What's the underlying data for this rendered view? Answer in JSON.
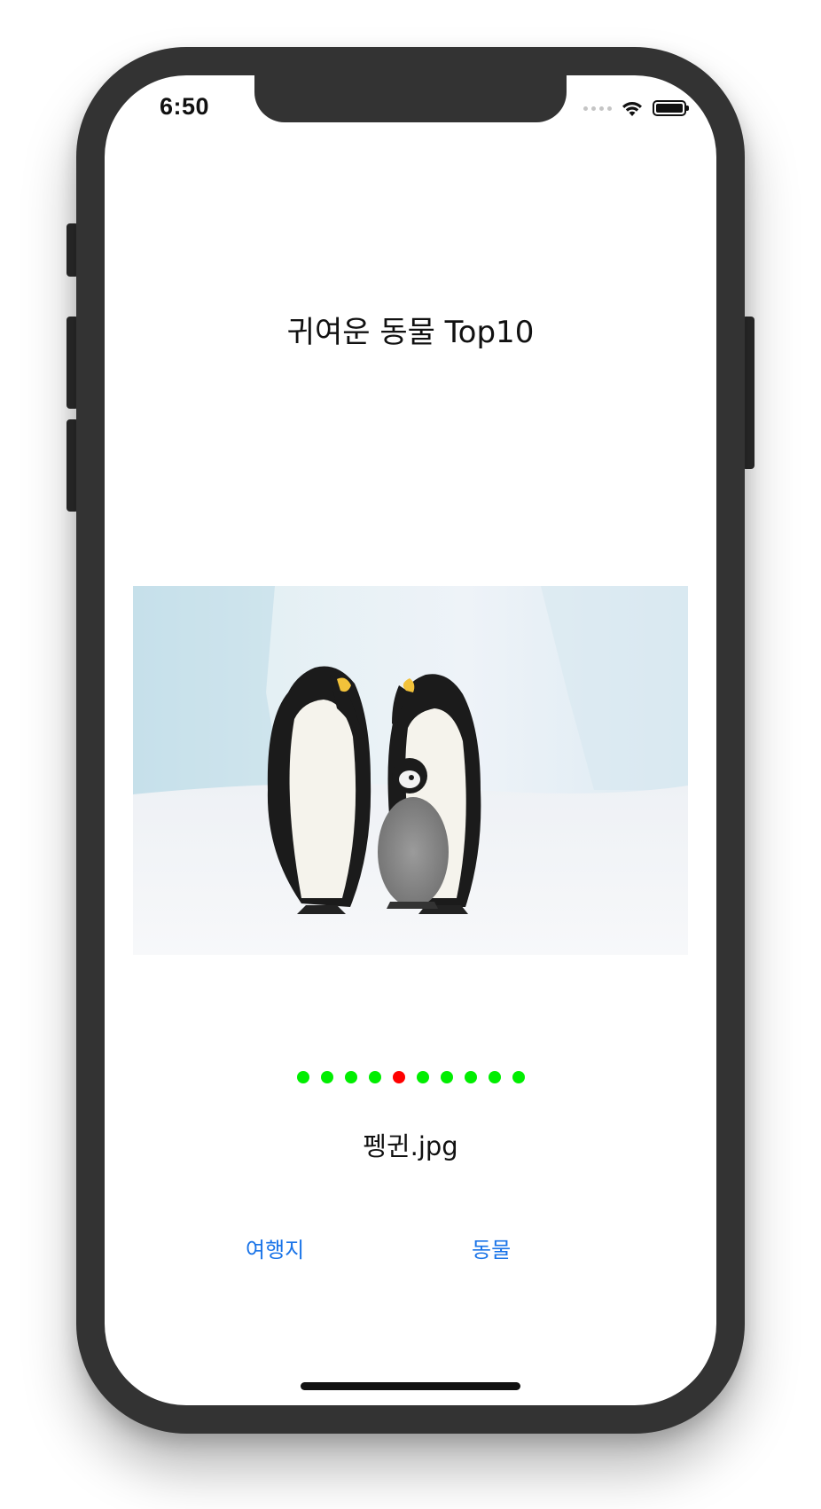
{
  "status_bar": {
    "time": "6:50",
    "icons": [
      "cellular-signal-icon",
      "wifi-icon",
      "battery-icon"
    ]
  },
  "main": {
    "title": "귀여운 동물 Top10",
    "image": {
      "subject": "penguin-family-photo"
    },
    "page_control": {
      "total": 10,
      "current_index": 4,
      "active_color": "#ff0000",
      "inactive_color": "#00ee00"
    },
    "file_name": "펭귄.jpg"
  },
  "buttons": {
    "travel_label": "여행지",
    "animal_label": "동물",
    "tint_color": "#1a74e8"
  }
}
